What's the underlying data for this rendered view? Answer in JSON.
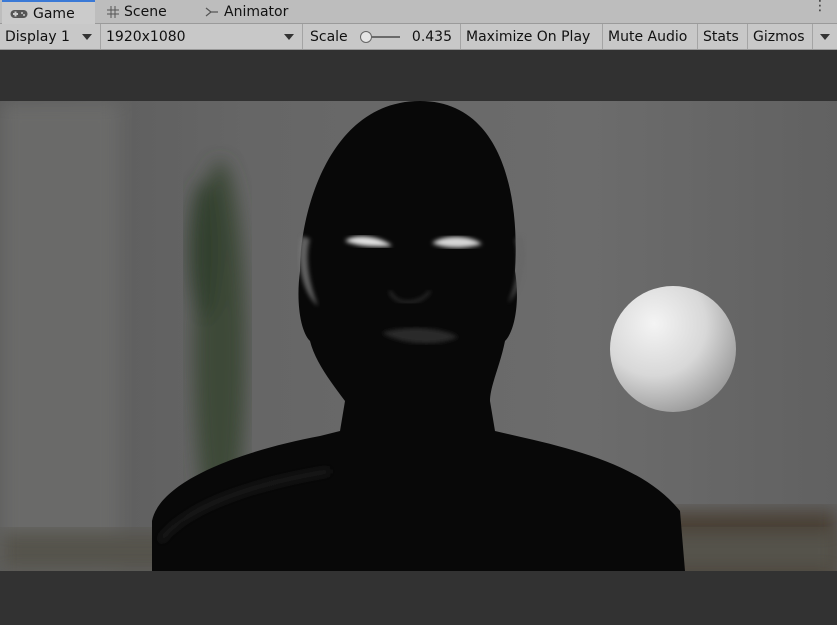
{
  "tabs": [
    {
      "label": "Game",
      "icon": "gamepad-icon",
      "active": true
    },
    {
      "label": "Scene",
      "icon": "grid-icon",
      "active": false
    },
    {
      "label": "Animator",
      "icon": "animator-icon",
      "active": false
    }
  ],
  "toolbar": {
    "display": "Display 1",
    "resolution": "1920x1080",
    "scale_label": "Scale",
    "scale_value": "0.435",
    "maximize": "Maximize On Play",
    "mute": "Mute Audio",
    "stats": "Stats",
    "gizmos": "Gizmos"
  },
  "colors": {
    "accent": "#3a79d6"
  }
}
